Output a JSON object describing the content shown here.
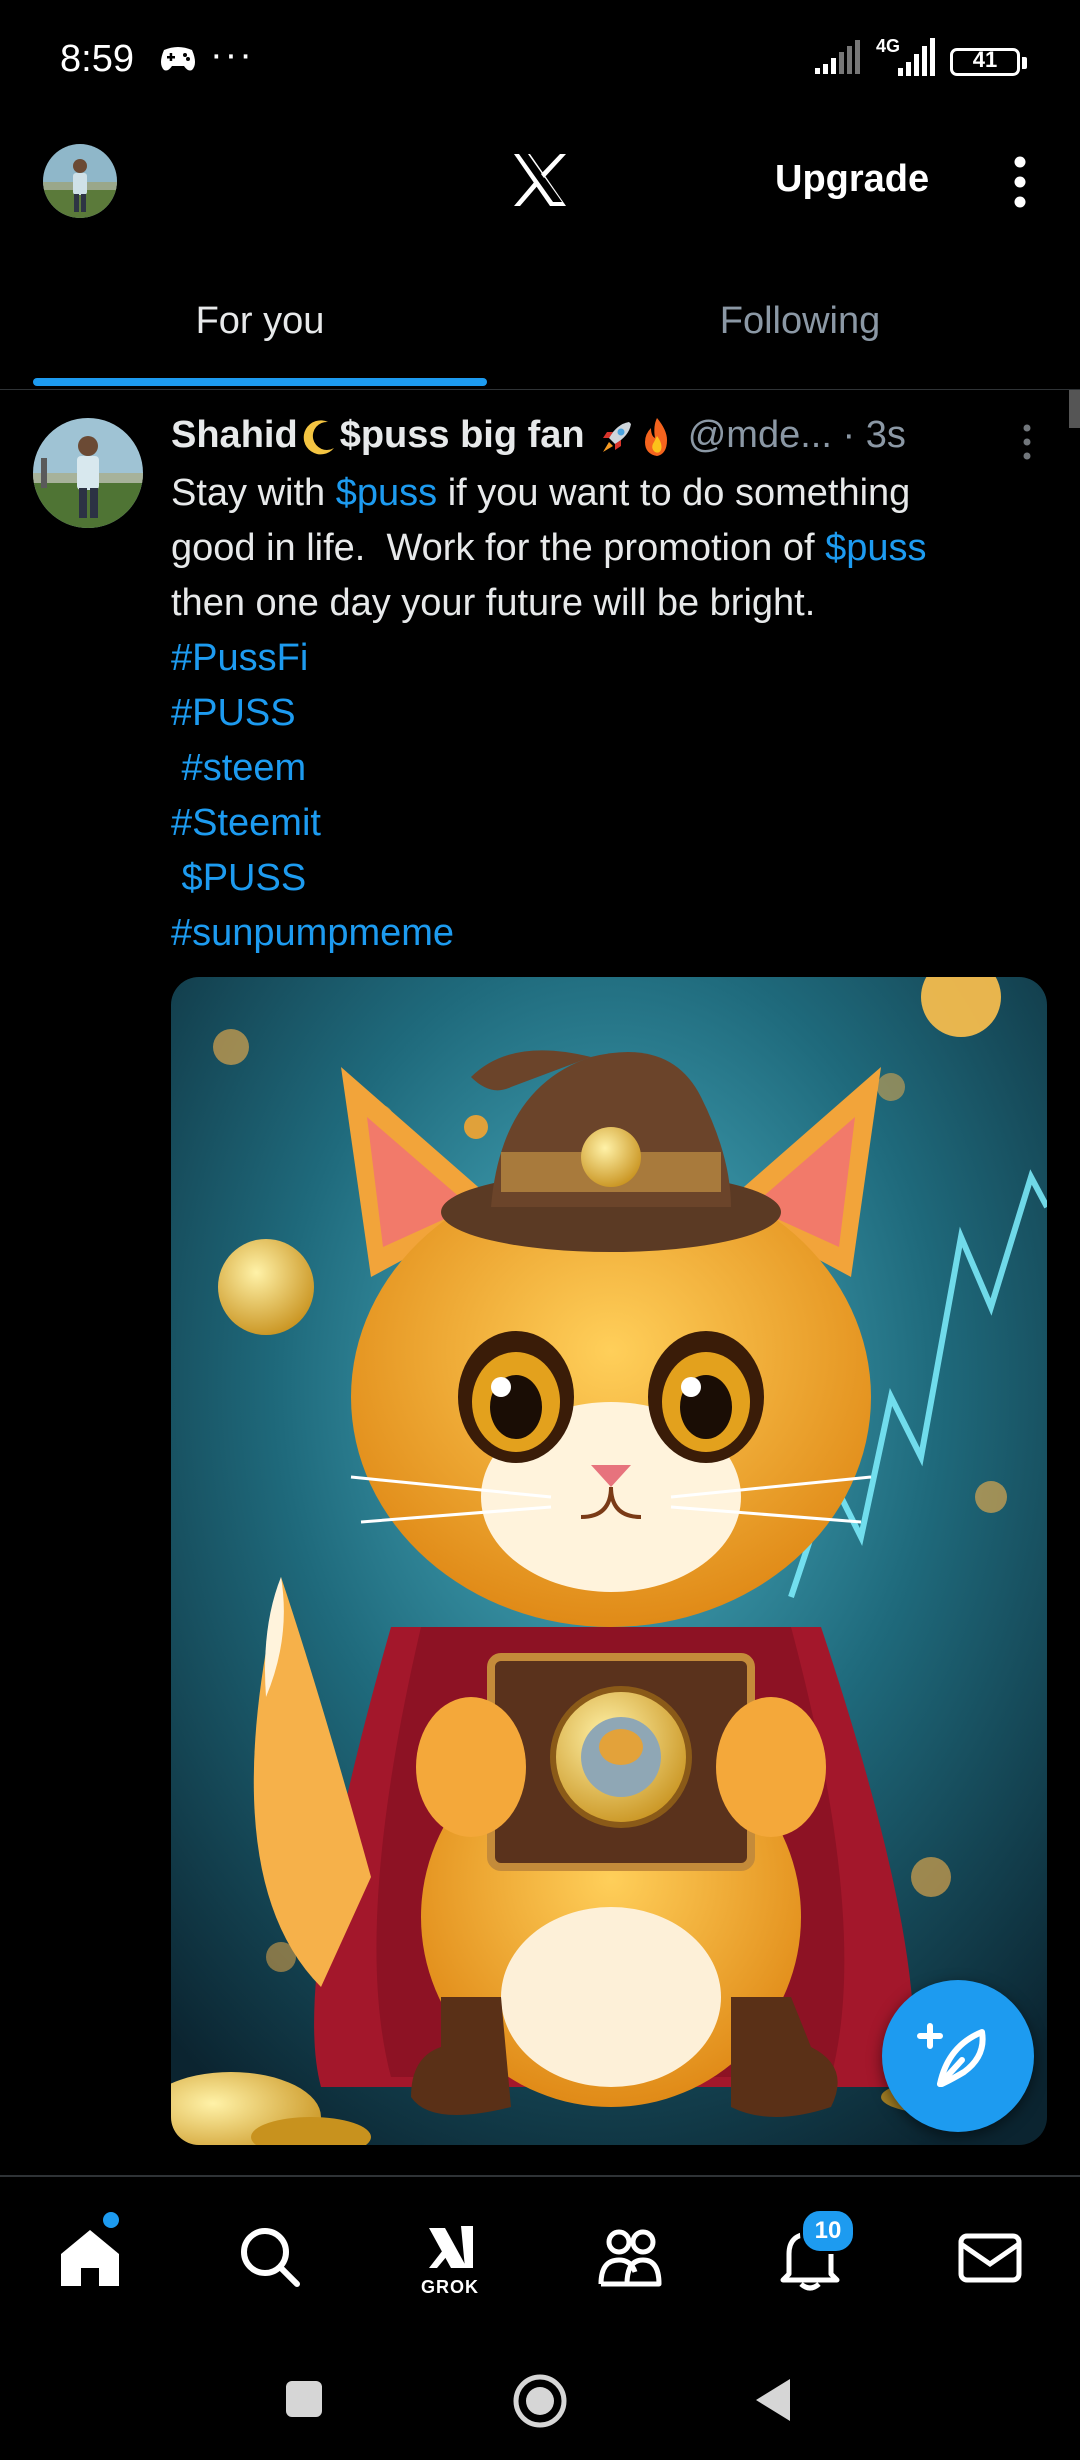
{
  "status_bar": {
    "time": "8:59",
    "overflow": "···",
    "network": "4G",
    "battery": "41",
    "icons": [
      "game-controller-icon",
      "signal-icon",
      "network-4g-icon",
      "battery-icon"
    ]
  },
  "header": {
    "logo": "X",
    "upgrade_label": "Upgrade"
  },
  "tabs": [
    {
      "label": "For you",
      "active": true
    },
    {
      "label": "Following",
      "active": false
    }
  ],
  "post": {
    "author_name": "Shahid",
    "author_name_2": "$puss big fan",
    "author_emojis": [
      "crescent-moon-icon",
      "rocket-icon",
      "fire-icon"
    ],
    "handle": "@mde...",
    "separator": "·",
    "time": "3s",
    "body": {
      "l1_a": "Stay with ",
      "l1_link": "$puss",
      "l1_b": " if you want to do something",
      "l2_a": "good in life.  Work for the promotion of ",
      "l2_link": "$puss",
      "l3": "then one day your future will be bright.",
      "tags": [
        "#PussFi",
        "#PUSS",
        " #steem",
        "#Steemit",
        " $PUSS",
        "#sunpumpmeme"
      ]
    },
    "image_alt": "cartoon cat in wizard hat and red cape holding a coin box"
  },
  "bottom_nav": {
    "grok_label": "GROK",
    "notifications_count": "10",
    "items": [
      "home-icon",
      "search-icon",
      "grok-icon",
      "communities-icon",
      "notifications-icon",
      "messages-icon"
    ]
  },
  "colors": {
    "accent": "#1d9bf0",
    "background": "#000000",
    "text_primary": "#e7e9ea",
    "text_secondary": "#8b98a5"
  }
}
